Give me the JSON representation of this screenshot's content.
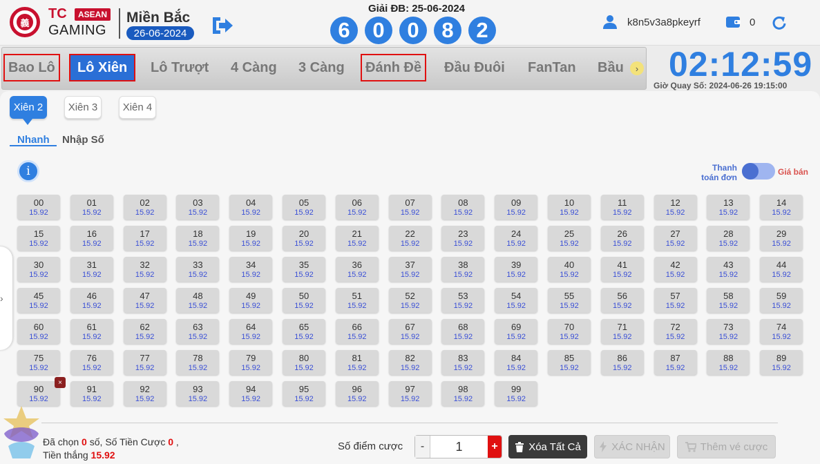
{
  "header": {
    "brand_tc": "TC",
    "brand_asean": "ASEAN",
    "brand_gaming": "GAMING",
    "logo_char": "義",
    "region_name": "Miền Bắc",
    "region_date": "26-06-2024",
    "special_title": "Giải ĐB: 25-06-2024",
    "special_numbers": [
      "6",
      "0",
      "0",
      "8",
      "2"
    ],
    "username": "k8n5v3a8pkeyrf",
    "balance": "0"
  },
  "tabs": [
    "Bao Lô",
    "Lô Xiên",
    "Lô Trượt",
    "4 Càng",
    "3 Càng",
    "Đánh Đề",
    "Đầu Đuôi",
    "FanTan",
    "Bầu"
  ],
  "timer": {
    "countdown": "02:12:59",
    "draw_time": "Giờ Quay Số: 2024-06-26 19:15:00"
  },
  "sub_tabs": [
    "Xiên 2",
    "Xiên 3",
    "Xiên 4"
  ],
  "modes": [
    "Nhanh",
    "Nhập Số"
  ],
  "info_label": "i",
  "pay_label": "Thanh toán đơn",
  "sell_label": "Giá bán",
  "odds": "15.92",
  "numbers": [
    "00",
    "01",
    "02",
    "03",
    "04",
    "05",
    "06",
    "07",
    "08",
    "09",
    "10",
    "11",
    "12",
    "13",
    "14",
    "15",
    "16",
    "17",
    "18",
    "19",
    "20",
    "21",
    "22",
    "23",
    "24",
    "25",
    "26",
    "27",
    "28",
    "29",
    "30",
    "31",
    "32",
    "33",
    "34",
    "35",
    "36",
    "37",
    "38",
    "39",
    "40",
    "41",
    "42",
    "43",
    "44",
    "45",
    "46",
    "47",
    "48",
    "49",
    "50",
    "51",
    "52",
    "53",
    "54",
    "55",
    "56",
    "57",
    "58",
    "59",
    "60",
    "61",
    "62",
    "63",
    "64",
    "65",
    "66",
    "67",
    "68",
    "69",
    "70",
    "71",
    "72",
    "73",
    "74",
    "75",
    "76",
    "77",
    "78",
    "79",
    "80",
    "81",
    "82",
    "83",
    "84",
    "85",
    "86",
    "87",
    "88",
    "89",
    "90",
    "91",
    "92",
    "93",
    "94",
    "95",
    "96",
    "97",
    "98",
    "99"
  ],
  "remove_mark": "×",
  "summary": {
    "selected_prefix": "Đã chọn",
    "selected_count": "0",
    "selected_suffix": "số,",
    "bet_prefix": "Số Tiền Cược",
    "bet_amount": "0",
    "bet_suffix": ",",
    "win_prefix": "Tiền thắng",
    "win_amount": "15.92"
  },
  "stepper": {
    "label": "Số điểm cược",
    "minus": "-",
    "value": "1",
    "plus": "+"
  },
  "buttons": {
    "clear": "Xóa Tất Cả",
    "confirm": "XÁC NHẬN",
    "add": "Thêm vé cược"
  },
  "colors": {
    "accent": "#2f7fe0",
    "brand_red": "#c8102e",
    "highlight_red": "#e01010",
    "odds_blue": "#3a4fd6"
  }
}
